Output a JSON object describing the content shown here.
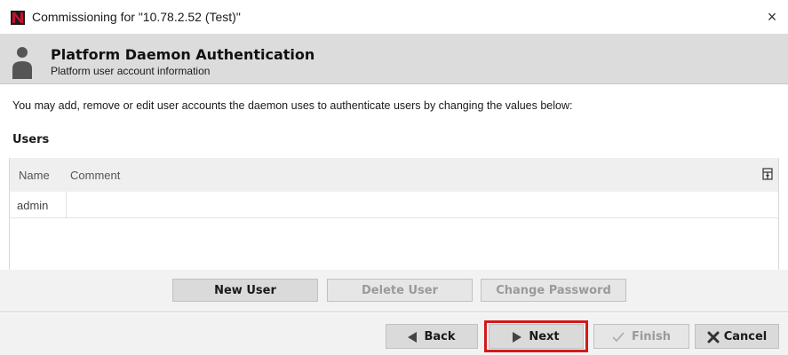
{
  "window": {
    "title": "Commissioning for \"10.78.2.52 (Test)\"",
    "close_glyph": "×",
    "logo_color": "#c8102e"
  },
  "header": {
    "title": "Platform Daemon Authentication",
    "subtitle": "Platform user account information",
    "icon": "user-icon"
  },
  "instructions": "You may add, remove or edit user accounts the daemon uses to authenticate users by changing the values below:",
  "users_section": {
    "label": "Users",
    "columns": [
      "Name",
      "Comment"
    ],
    "rows": [
      {
        "name": "admin",
        "comment": ""
      }
    ]
  },
  "actions": {
    "new_user": "New User",
    "delete_user": "Delete User",
    "change_password": "Change Password"
  },
  "wizard": {
    "back": "Back",
    "next": "Next",
    "finish": "Finish",
    "cancel": "Cancel"
  },
  "colors": {
    "highlight": "#d11a1a",
    "header_band": "#dcdcdc"
  }
}
